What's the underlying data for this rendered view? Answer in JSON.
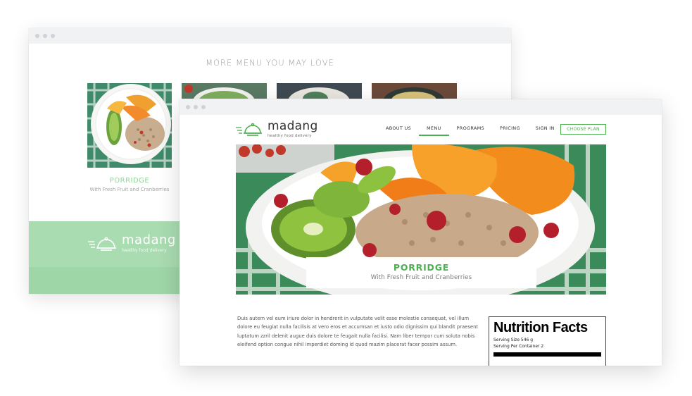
{
  "back_window": {
    "heading": "MORE MENU YOU MAY LOVE",
    "card": {
      "title": "PORRIDGE",
      "subtitle": "With Fresh Fruit and Cranberries"
    },
    "footer_logo": {
      "wordmark": "madang",
      "tagline": "healthy food delivery"
    }
  },
  "front_window": {
    "logo": {
      "wordmark": "madang",
      "tagline": "healthy food delivery"
    },
    "nav": {
      "items": [
        {
          "label": "ABOUT US"
        },
        {
          "label": "MENU"
        },
        {
          "label": "PROGRAMS"
        },
        {
          "label": "PRICING"
        },
        {
          "label": "SIGN IN"
        }
      ],
      "active": "MENU",
      "cta": "CHOOSE PLAN"
    },
    "hero": {
      "title": "PORRIDGE",
      "subtitle": "With Fresh Fruit and Cranberries"
    },
    "description": "Duis autem vel eum iriure dolor in hendrerit in vulputate velit esse molestie consequat, vel illum dolore eu feugiat nulla facilisis at vero eros et accumsan et iusto odio dignissim qui blandit praesent luptatum zzril delenit augue duis dolore te feugait nulla facilisi. Nam liber tempor cum soluta nobis eleifend option congue nihil imperdiet doming id quod mazim placerat facer possim assum.",
    "nutrition": {
      "title": "Nutrition Facts",
      "serving_size": "Serving Size 546 g",
      "servings_per_container": "Serving Per Container 2"
    }
  },
  "colors": {
    "accent": "#4caf50",
    "footer_green": "#a9dcb0",
    "title_green": "#8fd49a"
  }
}
